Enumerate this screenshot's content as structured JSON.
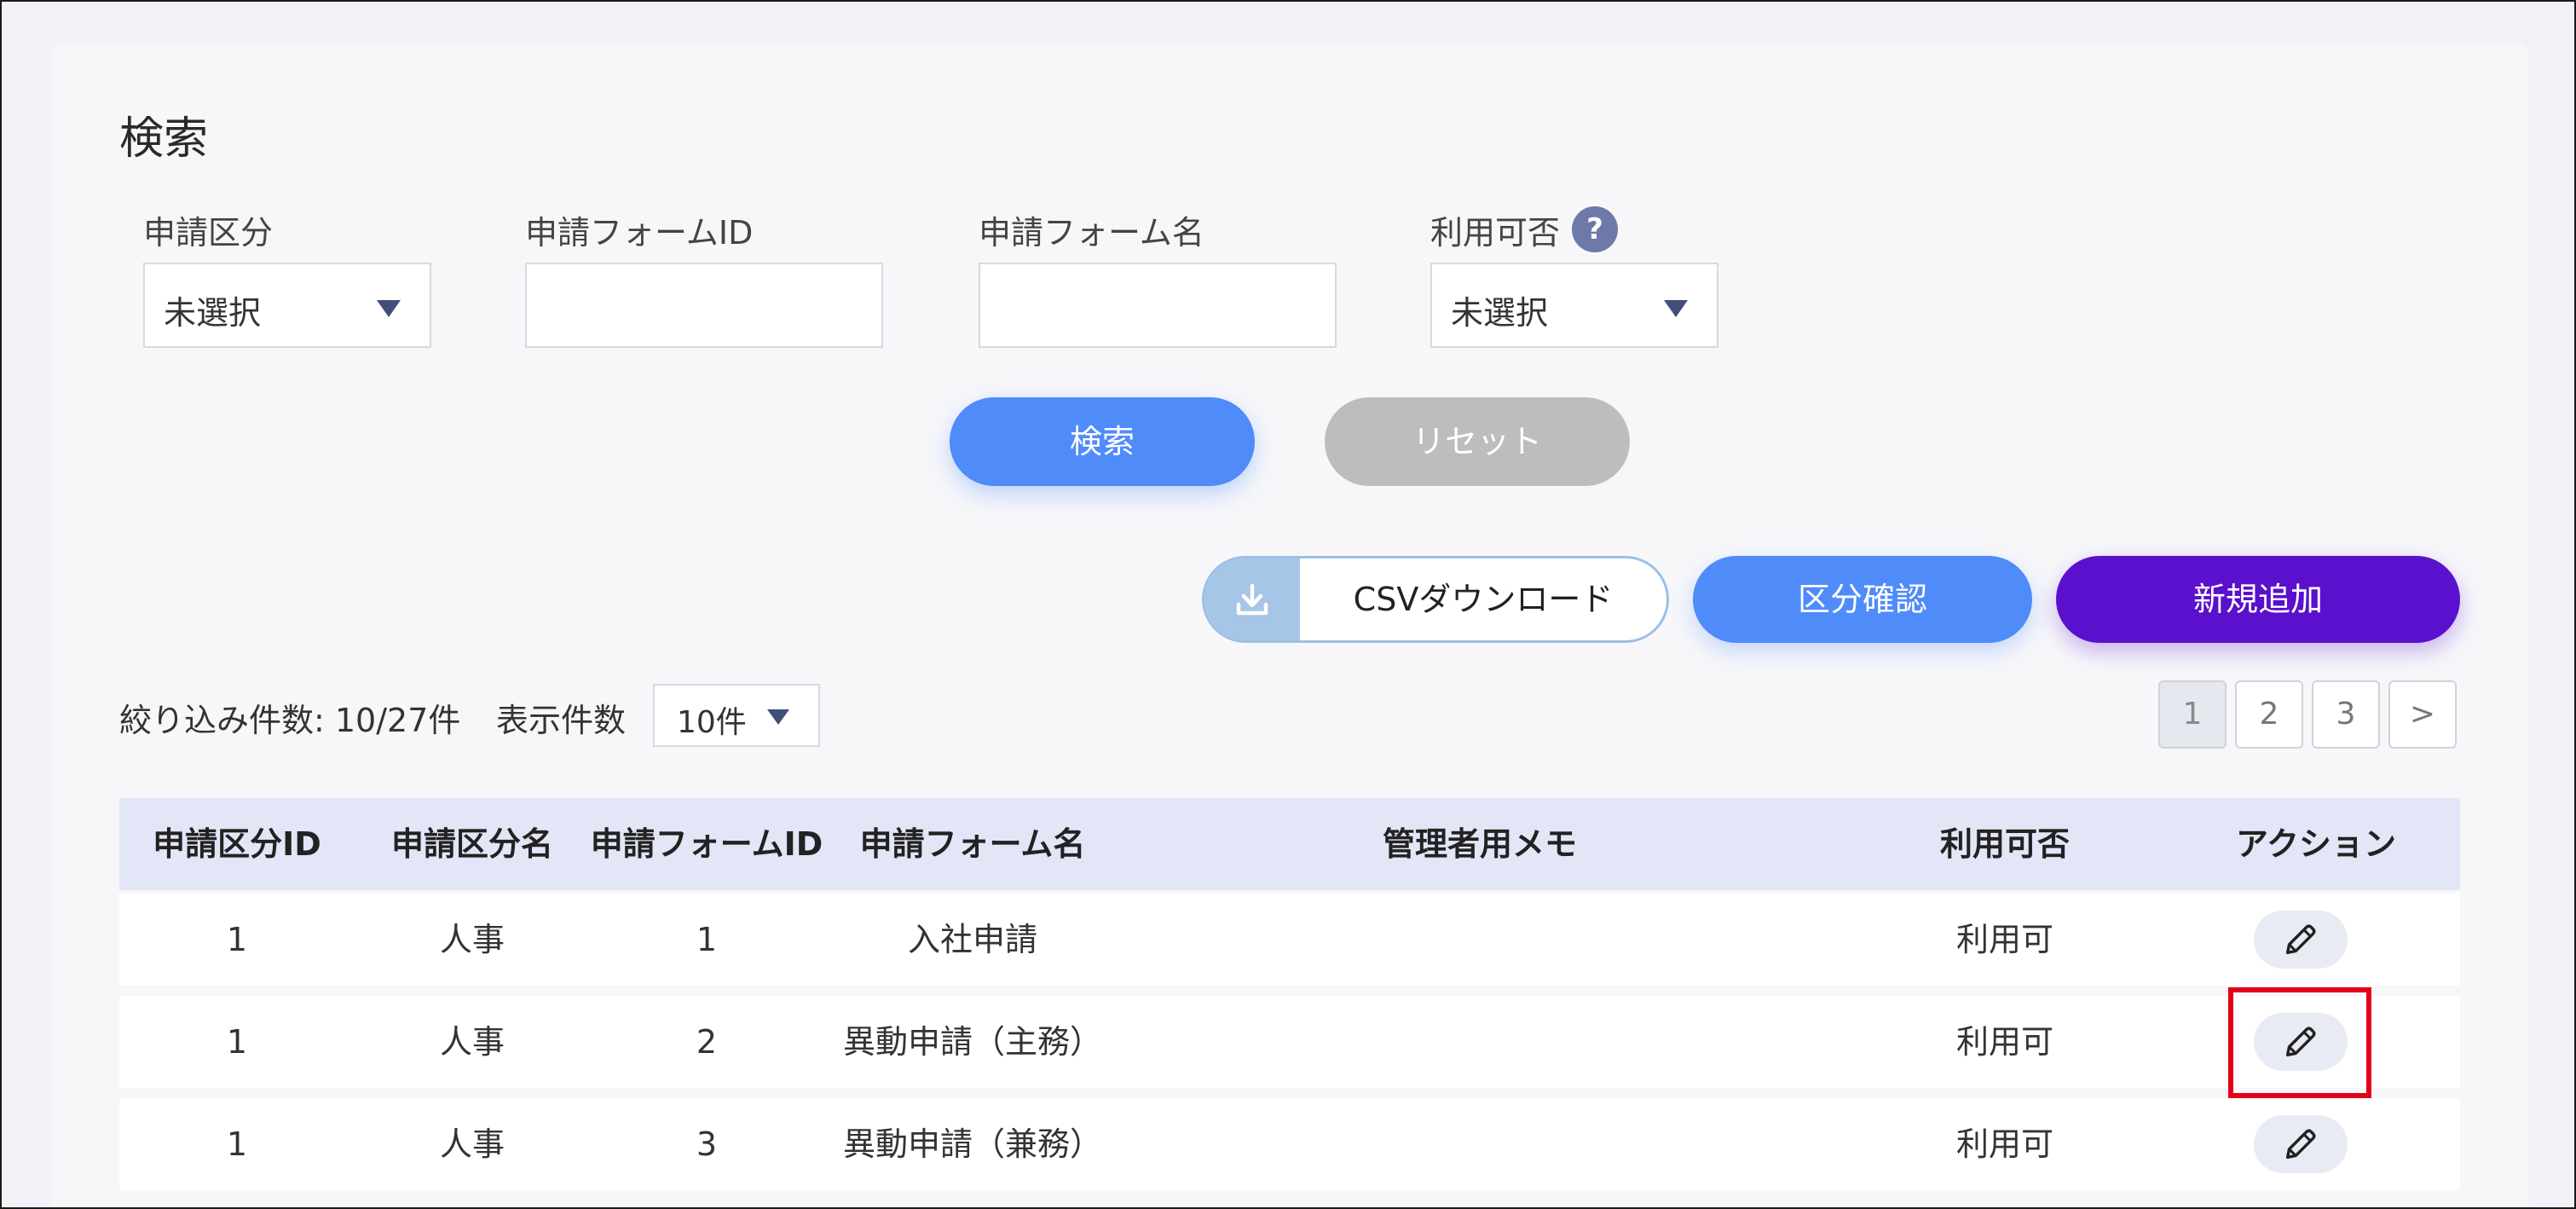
{
  "search": {
    "title": "検索",
    "category_label": "申請区分",
    "category_value": "未選択",
    "form_id_label": "申請フォームID",
    "form_id_value": "",
    "form_name_label": "申請フォーム名",
    "form_name_value": "",
    "availability_label": "利用可否",
    "availability_value": "未選択",
    "help_icon": "?",
    "search_button": "検索",
    "reset_button": "リセット"
  },
  "actions": {
    "csv_download": "CSVダウンロード",
    "category_check": "区分確認",
    "add_new": "新規追加",
    "icons": {
      "download": "download-icon"
    }
  },
  "listing": {
    "filter_count": "絞り込み件数: 10/27件",
    "display_label": "表示件数",
    "per_page_value": "10件",
    "pages": [
      "1",
      "2",
      "3",
      ">"
    ]
  },
  "table": {
    "headers": [
      "申請区分ID",
      "申請区分名",
      "申請フォームID",
      "申請フォーム名",
      "管理者用メモ",
      "利用可否",
      "アクション"
    ],
    "rows": [
      {
        "category_id": "1",
        "category_name": "人事",
        "form_id": "1",
        "form_name": "入社申請",
        "memo": "",
        "availability": "利用可"
      },
      {
        "category_id": "1",
        "category_name": "人事",
        "form_id": "2",
        "form_name": "異動申請（主務）",
        "memo": "",
        "availability": "利用可"
      },
      {
        "category_id": "1",
        "category_name": "人事",
        "form_id": "3",
        "form_name": "異動申請（兼務）",
        "memo": "",
        "availability": "利用可"
      }
    ]
  },
  "colors": {
    "primary_blue": "#4f8bf9",
    "purple": "#5a10cc",
    "reset_gray": "#bdbdbd",
    "header_bg": "#e2e6f6",
    "highlight_red": "#e3001b"
  }
}
